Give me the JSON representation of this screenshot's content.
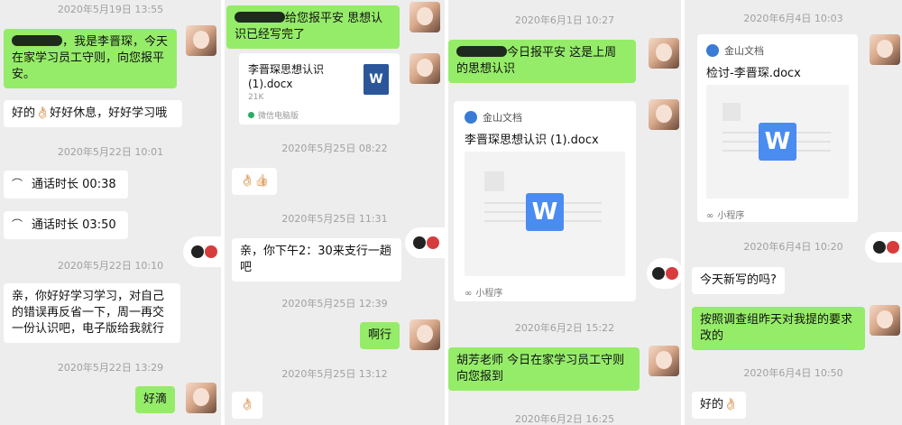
{
  "panel1": {
    "ts1": "2020年5月19日 13:55",
    "msg1": "，我是李晋琛，今天在家学习员工守则，向您报平安。",
    "msg2": "好的👌🏻好好休息，好好学习哦",
    "ts2": "2020年5月22日 10:01",
    "call1": "通话时长 00:38",
    "call2": "通话时长 03:50",
    "ts3": "2020年5月22日 10:10",
    "msg3": "亲，你好好学习学习，对自己的错误再反省一下，周一再交一份认识吧，电子版给我就行",
    "ts4": "2020年5月22日 13:29",
    "msg4": "好滴"
  },
  "panel2": {
    "msg1": "给您报平安 思想认识已经写完了",
    "file_name": "李晋琛思想认识(1).docx",
    "file_size": "21K",
    "file_source": "微信电脑版",
    "ts1": "2020年5月25日 08:22",
    "msg2": "👌🏻👍🏻",
    "ts2": "2020年5月25日 11:31",
    "msg3": "亲，你下午2：30来支行一趟吧",
    "ts3": "2020年5月25日 12:39",
    "msg4": "啊行",
    "ts4": "2020年5月25日 13:12",
    "msg5": "👌🏻"
  },
  "panel3": {
    "ts1": "2020年6月1日 10:27",
    "msg1": "今日报平安 这是上周的思想认识",
    "card_app": "金山文档",
    "card_title": "李晋琛思想认识 (1).docx",
    "card_footer": "小程序",
    "ts2": "2020年6月2日 15:22",
    "msg2": "胡芳老师 今日在家学习员工守则 向您报到",
    "ts3": "2020年6月2日 16:25"
  },
  "panel4": {
    "ts1": "2020年6月4日 10:03",
    "card_app": "金山文档",
    "card_title": "检讨-李晋琛.docx",
    "card_footer": "小程序",
    "ts2": "2020年6月4日 10:20",
    "msg1": "今天新写的吗?",
    "msg2": "按照调查组昨天对我提的要求改的",
    "ts3": "2020年6月4日 10:50",
    "msg3": "好的👌🏻"
  },
  "icons": {
    "w_letter": "W",
    "phone_glyph": "☎"
  }
}
